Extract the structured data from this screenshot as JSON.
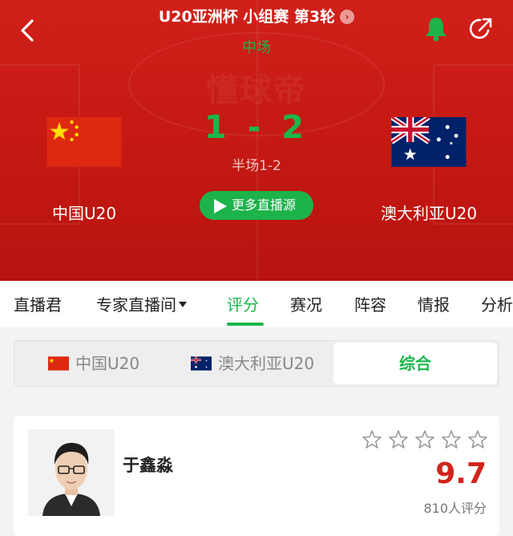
{
  "header": {
    "title": "U20亚洲杯 小组赛 第3轮",
    "status": "中场",
    "watermark": "懂球帝",
    "live_button_label": "更多直播源"
  },
  "match": {
    "home_team": "中国U20",
    "away_team": "澳大利亚U20",
    "home_score": "1",
    "away_score": "2",
    "score_separator": "-",
    "halftime": "半场1-2"
  },
  "tabs": [
    {
      "label": "直播君"
    },
    {
      "label": "专家直播间"
    },
    {
      "label": "评分"
    },
    {
      "label": "赛况"
    },
    {
      "label": "阵容"
    },
    {
      "label": "情报"
    },
    {
      "label": "分析"
    }
  ],
  "active_tab": "评分",
  "segment": {
    "home": "中国U20",
    "away": "澳大利亚U20",
    "combined": "综合",
    "selected": "综合"
  },
  "expert_card": {
    "name": "于鑫淼",
    "stars_total": 5,
    "stars_filled": 0,
    "rating": "9.7",
    "rating_count": "810人评分"
  },
  "icons": {
    "back": "back-arrow-icon",
    "bell": "bell-icon",
    "share": "share-icon",
    "play": "play-icon",
    "star": "star-outline-icon"
  },
  "colors": {
    "header_red": "#c41812",
    "accent_green": "#1bb64b",
    "rating_red": "#d3241c"
  }
}
